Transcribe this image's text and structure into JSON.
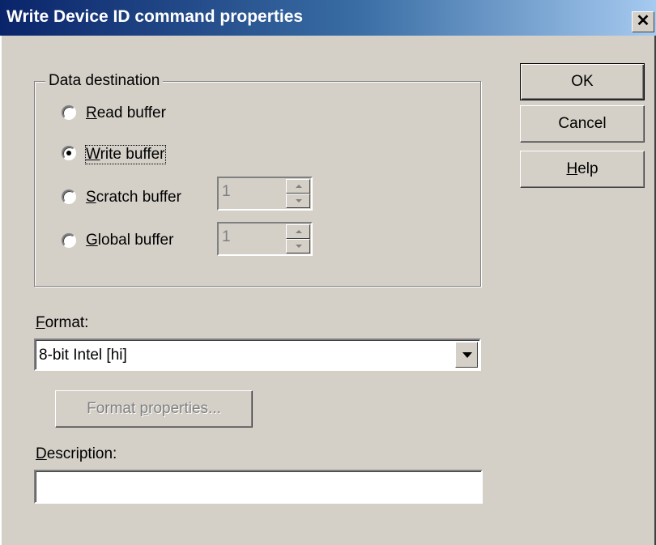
{
  "window": {
    "title": "Write Device ID command properties",
    "close_glyph": "✕"
  },
  "group": {
    "label": "Data destination",
    "radios": [
      {
        "label": "Read buffer",
        "mnemonic": "R",
        "rest": "ead buffer",
        "checked": false
      },
      {
        "label": "Write buffer",
        "mnemonic": "W",
        "rest": "rite buffer",
        "checked": true
      },
      {
        "label": "Scratch buffer",
        "mnemonic": "S",
        "rest": "cratch buffer",
        "checked": false
      },
      {
        "label": "Global buffer",
        "mnemonic": "G",
        "rest": "lobal buffer",
        "checked": false
      }
    ],
    "scratch_spin_value": "1",
    "global_spin_value": "1"
  },
  "buttons": {
    "ok": "OK",
    "cancel": "Cancel",
    "help_mnemonic": "H",
    "help_rest": "elp"
  },
  "format": {
    "label_mnemonic": "F",
    "label_rest": "ormat:",
    "selected": "8-bit Intel  [hi]",
    "properties_pre": "Format ",
    "properties_mnemonic": "p",
    "properties_rest": "roperties..."
  },
  "description": {
    "label_mnemonic": "D",
    "label_rest": "escription:",
    "value": ""
  },
  "colors": {
    "face": "#d4d0c8",
    "title_start": "#0a246a",
    "title_end": "#a6caf0",
    "disabled_text": "#808080"
  }
}
